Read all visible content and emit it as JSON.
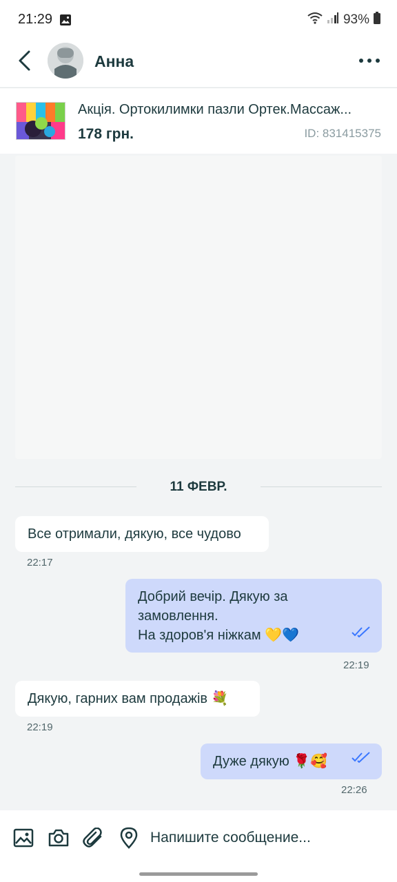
{
  "status_bar": {
    "time": "21:29",
    "battery": "93%"
  },
  "header": {
    "contact_name": "Анна"
  },
  "product": {
    "title": "Акція. Ортокилимки пазли Ортек.Массаж...",
    "price": "178 грн.",
    "id": "ID: 831415375"
  },
  "date_divider": "11 ФЕВР.",
  "messages": [
    {
      "direction": "in",
      "text": "Все отримали, дякую, все чудово",
      "time": "22:17"
    },
    {
      "direction": "out",
      "text": "Добрий вечір.  Дякую за\nзамовлення.\nНа здоров'я ніжкам 💛💙",
      "time": "22:19",
      "status": "read"
    },
    {
      "direction": "in",
      "text": "Дякую, гарних вам продажів 💐",
      "time": "22:19"
    },
    {
      "direction": "out",
      "text": "Дуже дякую  🌹🥰",
      "time": "22:26",
      "status": "read"
    }
  ],
  "composer": {
    "placeholder": "Напишите сообщение..."
  },
  "colors": {
    "outgoing_bubble": "#ced9fb",
    "incoming_bubble": "#ffffff",
    "read_ticks": "#3a77ff",
    "text": "#1d3a3e"
  },
  "icons": {
    "back": "back-arrow-icon",
    "more": "more-options-icon",
    "gallery": "image-icon",
    "camera": "camera-icon",
    "attach": "paperclip-icon",
    "location": "location-pin-icon"
  }
}
